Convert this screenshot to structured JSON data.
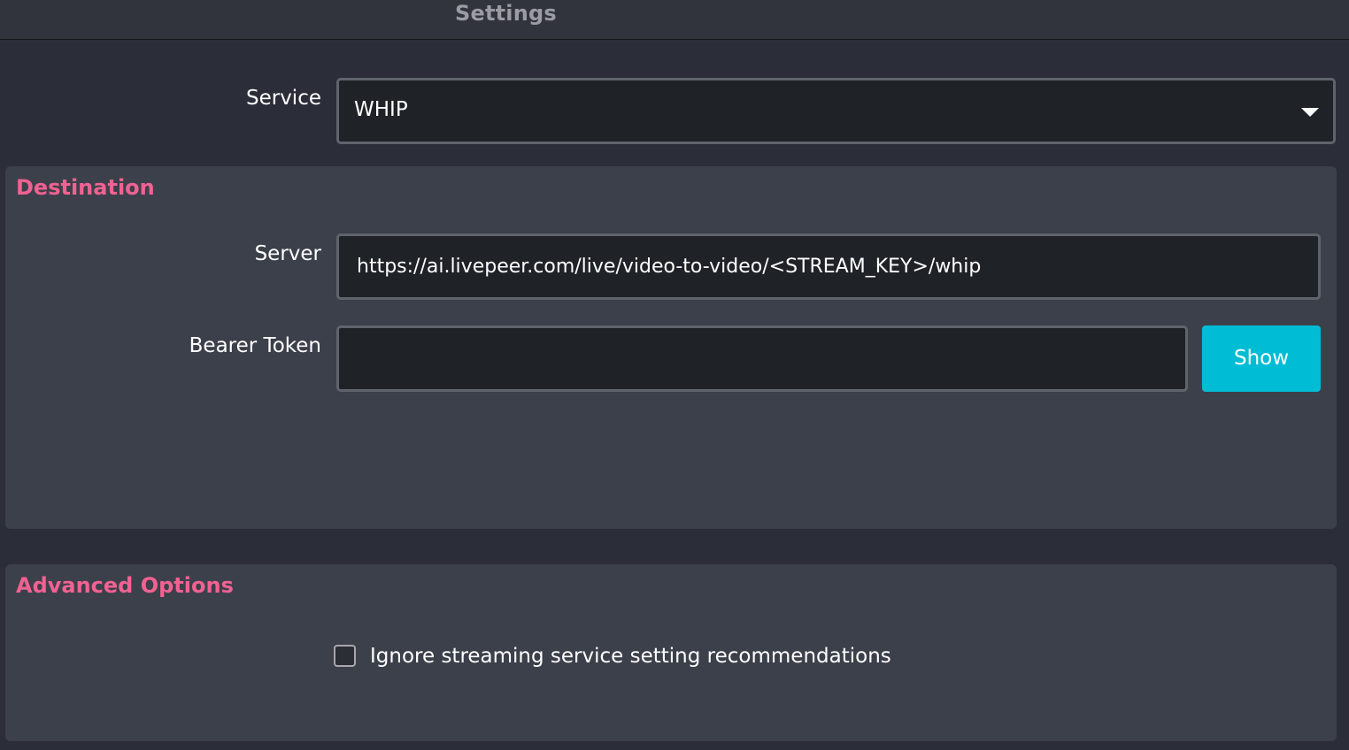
{
  "window": {
    "title": "Settings"
  },
  "service": {
    "label": "Service",
    "selected": "WHIP",
    "dropdown_icon": "triangle-down-icon"
  },
  "destination": {
    "title": "Destination",
    "server": {
      "label": "Server",
      "value": "https://ai.livepeer.com/live/video-to-video/<STREAM_KEY>/whip"
    },
    "bearer_token": {
      "label": "Bearer Token",
      "value": ""
    },
    "show_button": "Show"
  },
  "advanced": {
    "title": "Advanced Options",
    "ignore_recommendations": {
      "label": "Ignore streaming service setting recommendations",
      "checked": false
    }
  },
  "colors": {
    "accent_heading": "#f06292",
    "button": "#00bcd4",
    "background": "#2b2e38",
    "group": "#3c404a",
    "input": "#1f2227"
  }
}
